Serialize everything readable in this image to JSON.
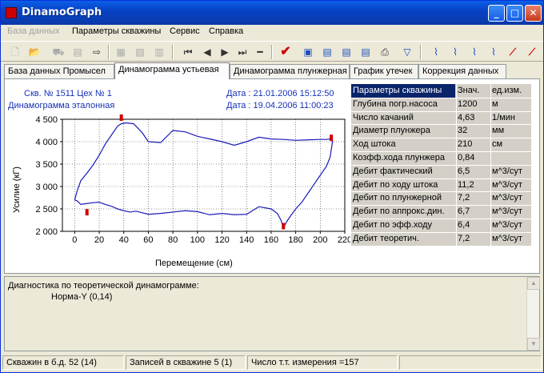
{
  "window": {
    "title": "DinamoGraph"
  },
  "menu": [
    "База данных",
    "Параметры скважины",
    "Сервис",
    "Справка"
  ],
  "tabs": [
    "База данных Промысел",
    "Динамограмма устьевая",
    "Динамограмма плунжерная",
    "График утечек",
    "Коррекция данных"
  ],
  "plot_header": {
    "well": "Скв. № 1511  Цех № 1",
    "type": "Динамограмма эталонная",
    "date1": "Дата : 21.01.2006 15:12:50",
    "date2": "Дата : 19.04.2006 11:00:23"
  },
  "chart_data": {
    "type": "line",
    "xlabel": "Перемещение  (см)",
    "ylabel": "Усилие  (кГ)",
    "xlim": [
      -10,
      220
    ],
    "ylim": [
      2000,
      4500
    ],
    "xticks": [
      0,
      20,
      40,
      60,
      80,
      100,
      120,
      140,
      160,
      180,
      200,
      220
    ],
    "yticks": [
      2000,
      2500,
      3000,
      3500,
      4000,
      4500
    ],
    "ytick_labels": [
      "2 000",
      "2 500",
      "3 000",
      "3 500",
      "4 000",
      "4 500"
    ],
    "series": [
      {
        "x": [
          0,
          2,
          5,
          10,
          15,
          20,
          25,
          30,
          35,
          38,
          42,
          48,
          55,
          60,
          70,
          80,
          90,
          100,
          110,
          120,
          130,
          140,
          150,
          160,
          170,
          180,
          190,
          200,
          205,
          208,
          210,
          210,
          208,
          205,
          200,
          195,
          190,
          185,
          180,
          176,
          173,
          170,
          168,
          165,
          160,
          150,
          140,
          130,
          120,
          110,
          100,
          90,
          80,
          70,
          60,
          50,
          45,
          40,
          35,
          30,
          25,
          20,
          15,
          10,
          5,
          2,
          0
        ],
        "y": [
          2700,
          2900,
          3130,
          3300,
          3480,
          3700,
          3950,
          4150,
          4350,
          4400,
          4420,
          4400,
          4200,
          4000,
          3980,
          4250,
          4220,
          4120,
          4060,
          4000,
          3920,
          4000,
          4100,
          4060,
          4050,
          4030,
          4040,
          4050,
          4050,
          4060,
          4030,
          4000,
          3650,
          3450,
          3250,
          3050,
          2850,
          2650,
          2500,
          2350,
          2230,
          2080,
          2250,
          2400,
          2500,
          2550,
          2380,
          2370,
          2400,
          2370,
          2440,
          2460,
          2430,
          2400,
          2380,
          2450,
          2430,
          2460,
          2500,
          2560,
          2600,
          2650,
          2640,
          2620,
          2600,
          2680,
          2700
        ]
      }
    ],
    "markers": [
      {
        "x": 38,
        "y": 4500
      },
      {
        "x": 10,
        "y": 2390
      },
      {
        "x": 170,
        "y": 2080
      },
      {
        "x": 209,
        "y": 4050
      }
    ],
    "grid": true
  },
  "params_table": {
    "headers": [
      "Параметры скважины",
      "Знач.",
      "ед.изм."
    ],
    "rows": [
      [
        "Глубина погр.насоса",
        "1200",
        "м"
      ],
      [
        "Число качаний",
        "4,63",
        "1/мин"
      ],
      [
        "Диаметр плунжера",
        "32",
        "мм"
      ],
      [
        "Ход штока",
        "210",
        "см"
      ],
      [
        "Козфф.хода плунжера",
        "0,84",
        ""
      ],
      [
        "Дебит фактический",
        "6,5",
        "м^3/сут"
      ],
      [
        "Дебит по ходу штока",
        "11,2",
        "м^3/сут"
      ],
      [
        "Дебит по плунжерной",
        "7,2",
        "м^3/сут"
      ],
      [
        "Дебит по аппрокс.дин.",
        "6,7",
        "м^3/сут"
      ],
      [
        "Дебит по эфф.ходу",
        "6,4",
        "м^3/сут"
      ],
      [
        "Дебит теоретич.",
        "7,2",
        "м^3/сут"
      ]
    ]
  },
  "diagnostics": {
    "title": "Диагностика по теоретической динамограмме:",
    "result": "Норма-Y (0,14)"
  },
  "status": [
    "Скважин в б.д. 52 (14)",
    "Записей в скважине 5 (1)",
    "Число т.т. измерения =157"
  ],
  "colors": {
    "curve": "#1a1ab8",
    "marker": "#d00000",
    "title_gradient": "#0a5fe8",
    "selected_header": "#0a246a"
  }
}
